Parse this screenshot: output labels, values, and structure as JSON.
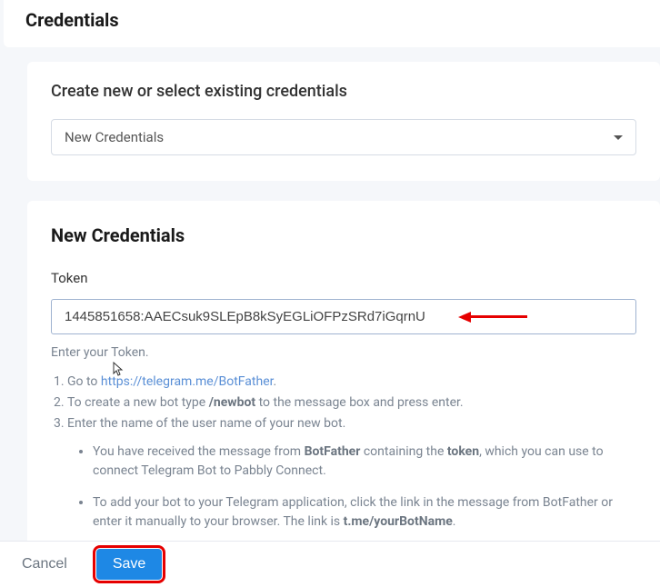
{
  "header": {
    "title": "Credentials"
  },
  "select_card": {
    "title": "Create new or select existing credentials",
    "selected": "New Credentials"
  },
  "creds_card": {
    "title": "New Credentials",
    "field_label": "Token",
    "token_value": "1445851658:AAECsuk9SLEpB8kSyEGLiOFPzSRd7iGqrnU",
    "helper": "Enter your Token."
  },
  "instructions": {
    "step1_prefix": "Go to ",
    "step1_link": "https://telegram.me/BotFather",
    "step1_suffix": ".",
    "step2_prefix": "To create a new bot type ",
    "step2_bold": "/newbot",
    "step2_suffix": " to the message box and press enter.",
    "step3": "Enter the name of the user name of your new bot.",
    "bullet1_a": "You have received the message from ",
    "bullet1_b": "BotFather",
    "bullet1_c": " containing the ",
    "bullet1_d": "token",
    "bullet1_e": ", which you can use to connect Telegram Bot to Pabbly Connect.",
    "bullet2_a": "To add your bot to your Telegram application, click the link in the message from BotFather or enter it manually to your browser. The link is ",
    "bullet2_b": "t.me/yourBotName",
    "bullet2_c": "."
  },
  "footer": {
    "cancel": "Cancel",
    "save": "Save"
  }
}
